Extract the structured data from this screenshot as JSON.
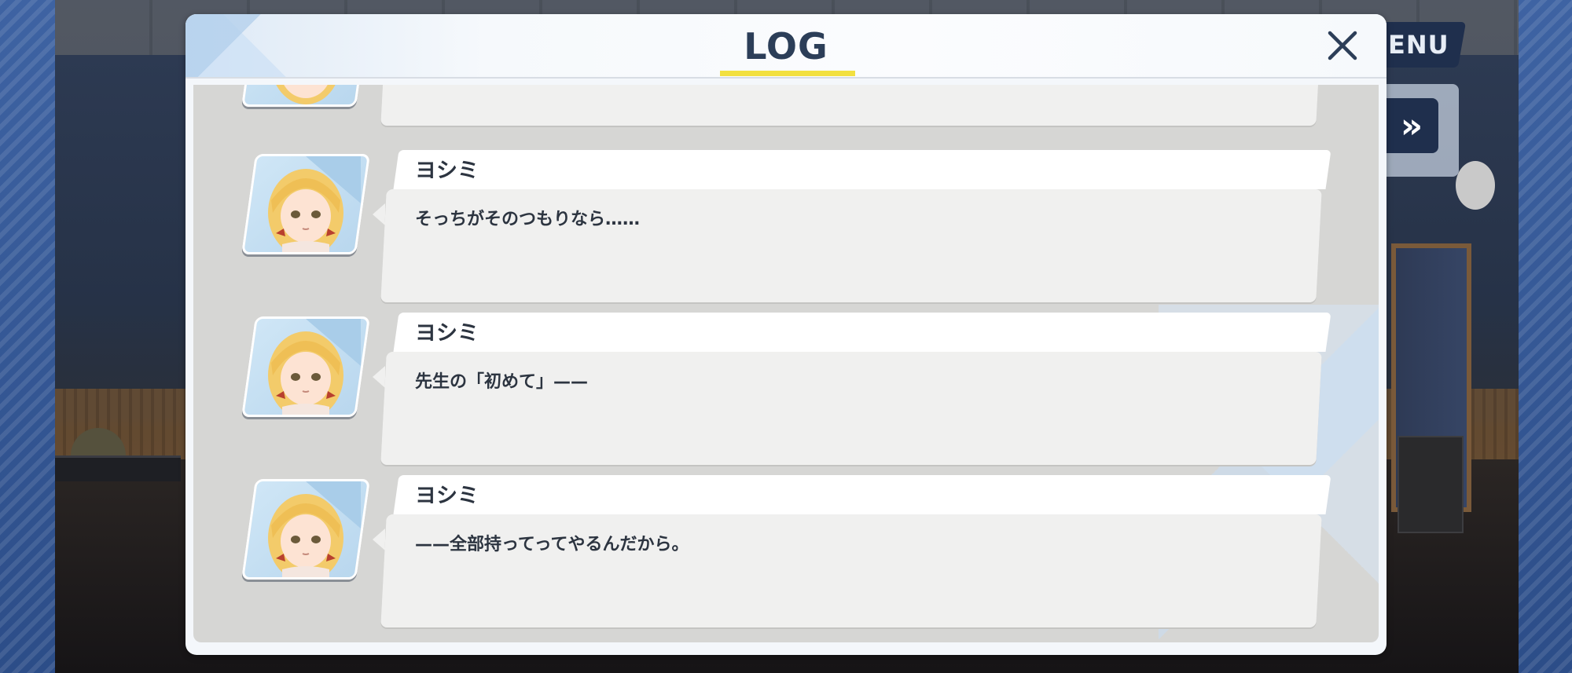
{
  "dialog": {
    "title": "LOG",
    "close_icon": "close-icon"
  },
  "game_controls": {
    "menu_label": "ENU",
    "skip_label": "»",
    "skip_icon": "fast-forward-icon"
  },
  "entries": [
    {
      "speaker": "",
      "message": ""
    },
    {
      "speaker": "ヨシミ",
      "message": "そっちがそのつもりなら……"
    },
    {
      "speaker": "ヨシミ",
      "message": "先生の「初めて」——"
    },
    {
      "speaker": "ヨシミ",
      "message": "——全部持ってってやるんだから。"
    }
  ],
  "colors": {
    "title_underline": "#f2e040",
    "title_text": "#2c3e58",
    "frame_blue": "#2f4f86"
  }
}
